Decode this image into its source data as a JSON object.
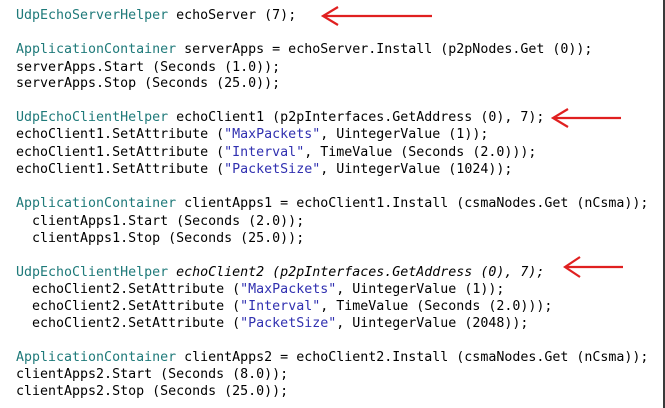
{
  "code": {
    "l1": {
      "a": "UdpEchoServerHelper",
      "b": " echoServer (7);"
    },
    "l2": {
      "a": "ApplicationContainer",
      "b": " serverApps = echoServer.Install (p2pNodes.Get (0));"
    },
    "l3": {
      "a": "serverApps.Start (Seconds (1.0));"
    },
    "l4": {
      "a": "serverApps.Stop (Seconds (25.0));"
    },
    "l5": {
      "a": "UdpEchoClientHelper",
      "b": " echoClient1 (p2pInterfaces.GetAddress (0), 7);"
    },
    "l6": {
      "a": "echoClient1.SetAttribute (",
      "s": "\"MaxPackets\"",
      "b": ", UintegerValue (1));"
    },
    "l7": {
      "a": "echoClient1.SetAttribute (",
      "s": "\"Interval\"",
      "b": ", TimeValue (Seconds (2.0)));"
    },
    "l8": {
      "a": "echoClient1.SetAttribute (",
      "s": "\"PacketSize\"",
      "b": ", UintegerValue (1024));"
    },
    "l9": {
      "a": "ApplicationContainer",
      "b": " clientApps1 = echoClient1.Install (csmaNodes.Get (nCsma));"
    },
    "l10": {
      "a": "  clientApps1.Start (Seconds (2.0));"
    },
    "l11": {
      "a": "  clientApps1.Stop (Seconds (25.0));"
    },
    "l12": {
      "a": "UdpEchoClientHelper",
      "b": " echoClient2 (p2pInterfaces.GetAddress (0), 7);"
    },
    "l13": {
      "a": "  echoClient2.SetAttribute (",
      "s": "\"MaxPackets\"",
      "b": ", UintegerValue (1));"
    },
    "l14": {
      "a": "  echoClient2.SetAttribute (",
      "s": "\"Interval\"",
      "b": ", TimeValue (Seconds (2.0)));"
    },
    "l15": {
      "a": "  echoClient2.SetAttribute (",
      "s": "\"PacketSize\"",
      "b": ", UintegerValue (2048));"
    },
    "l16": {
      "a": "ApplicationContainer",
      "b": " clientApps2 = echoClient2.Install (csmaNodes.Get (nCsma));"
    },
    "l17": {
      "a": "clientApps2.Start (Seconds (8.0));"
    },
    "l18": {
      "a": "clientApps2.Stop (Seconds (25.0));"
    }
  },
  "colors": {
    "type": "#1f7a7a",
    "string": "#3030b0",
    "arrow": "#e02020"
  },
  "icons": [
    "red-arrow-icon"
  ]
}
